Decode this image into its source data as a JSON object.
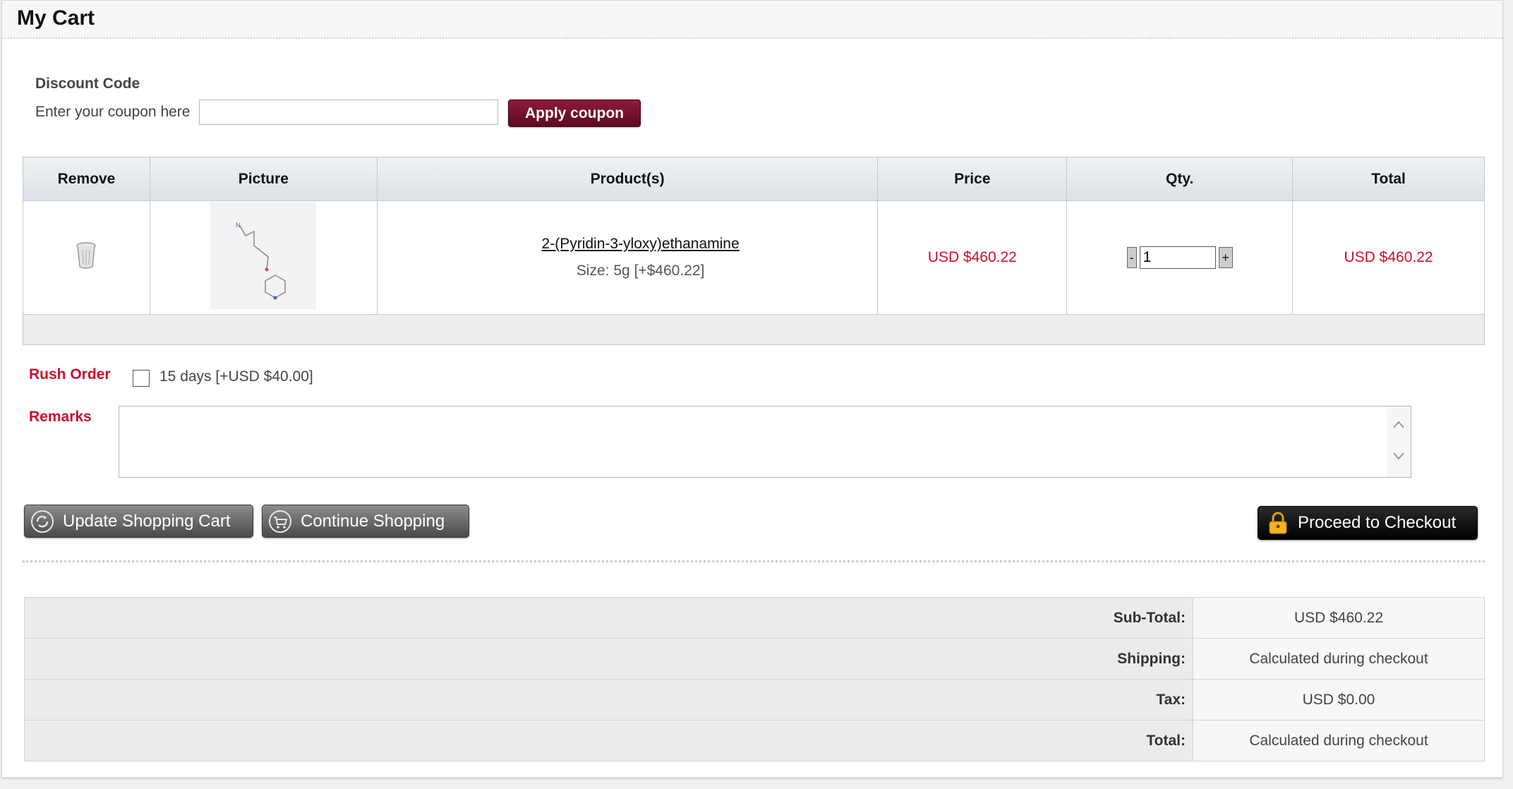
{
  "page": {
    "title": "My Cart"
  },
  "discount": {
    "title": "Discount Code",
    "label": "Enter your coupon here",
    "value": "",
    "apply_label": "Apply coupon"
  },
  "cart": {
    "headers": {
      "remove": "Remove",
      "picture": "Picture",
      "product": "Product(s)",
      "price": "Price",
      "qty": "Qty.",
      "total": "Total"
    },
    "items": [
      {
        "name": "2-(Pyridin-3-yloxy)ethanamine",
        "size": "Size: 5g [+$460.22]",
        "price": "USD $460.22",
        "qty": "1",
        "qty_minus": "-",
        "qty_plus": "+",
        "total": "USD $460.22",
        "remove_icon": "trash-icon",
        "picture_icon": "molecule-structure"
      }
    ]
  },
  "rush": {
    "label": "Rush Order",
    "option": "15 days [+USD $40.00]",
    "checked": false
  },
  "remarks": {
    "label": "Remarks",
    "value": ""
  },
  "actions": {
    "update": "Update Shopping Cart",
    "continue": "Continue Shopping",
    "checkout": "Proceed to Checkout"
  },
  "totals": {
    "subtotal_label": "Sub-Total:",
    "subtotal": "USD $460.22",
    "shipping_label": "Shipping:",
    "shipping": "Calculated during checkout",
    "tax_label": "Tax:",
    "tax": "USD $0.00",
    "total_label": "Total:",
    "total": "Calculated during checkout"
  },
  "colors": {
    "accent_red": "#c8102e",
    "coupon_button": "#7a1230",
    "checkout_button": "#111111"
  }
}
